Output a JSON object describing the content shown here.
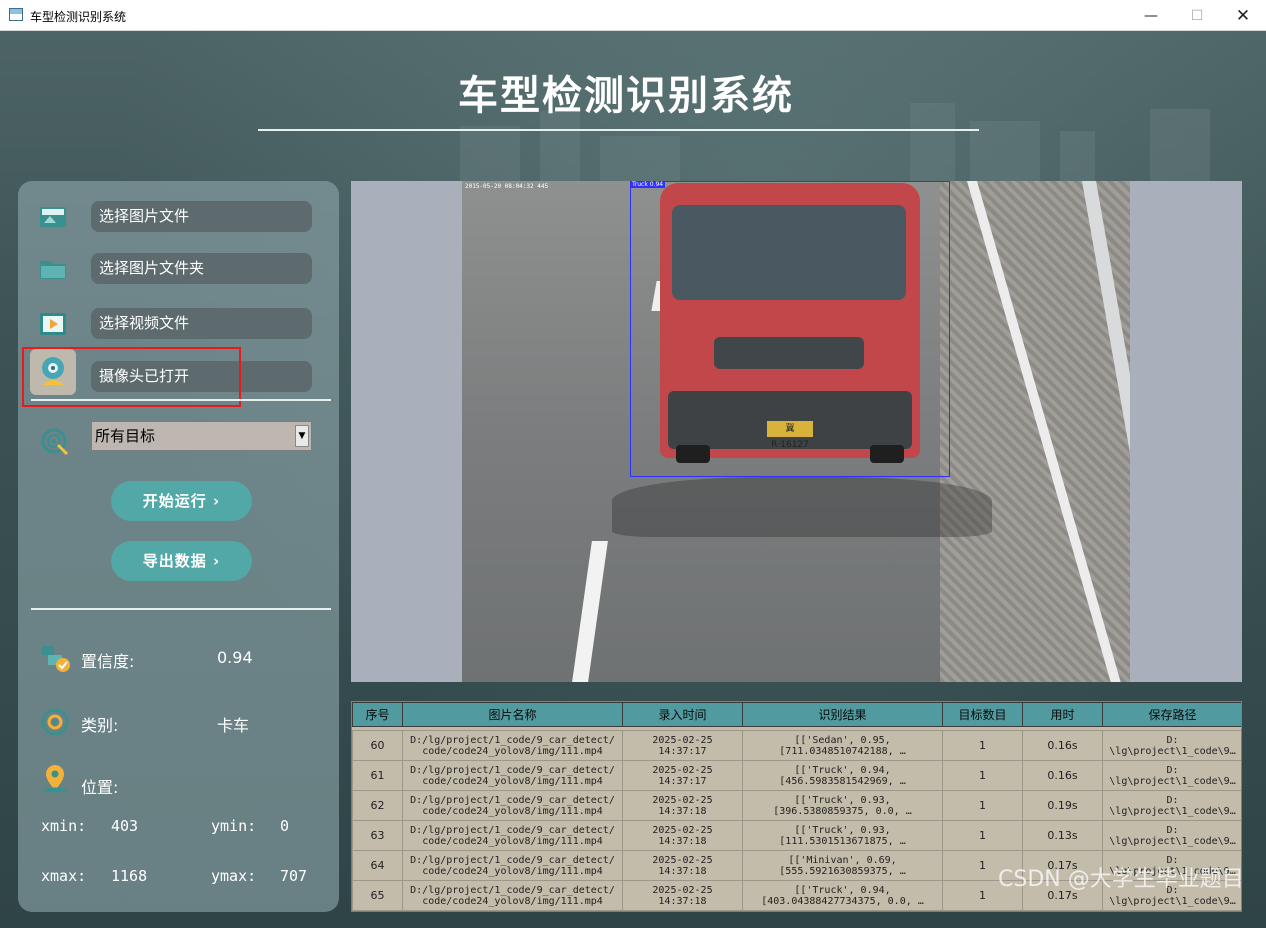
{
  "window": {
    "title": "车型检测识别系统",
    "min": "—",
    "max": "☐",
    "close": "✕"
  },
  "app_title": "车型检测识别系统",
  "sidebar": {
    "buttons": [
      {
        "label": "选择图片文件",
        "icon": "image-file-icon"
      },
      {
        "label": "选择图片文件夹",
        "icon": "folder-icon"
      },
      {
        "label": "选择视频文件",
        "icon": "video-file-icon"
      },
      {
        "label": "摄像头已打开",
        "icon": "camera-icon"
      }
    ],
    "target_select": {
      "value": "所有目标",
      "arrow": "▼"
    },
    "run_button": "开始运行 ›",
    "export_button": "导出数据 ›",
    "confidence": {
      "label": "置信度:",
      "value": "0.94"
    },
    "category": {
      "label": "类别:",
      "value": "卡车"
    },
    "position": {
      "label": "位置:"
    },
    "coords": {
      "xmin_label": "xmin:",
      "xmin": "403",
      "ymin_label": "ymin:",
      "ymin": "0",
      "xmax_label": "xmax:",
      "xmax": "1168",
      "ymax_label": "ymax:",
      "ymax": "707"
    }
  },
  "viewer": {
    "detection_label": "Truck 0.94",
    "plate": "冀R·16127",
    "timestamp": "2015-05-20 08:04:32 445"
  },
  "table": {
    "headers": [
      "序号",
      "图片名称",
      "录入时间",
      "识别结果",
      "目标数目",
      "用时",
      "保存路径"
    ],
    "rows": [
      [
        "60",
        "D:/lg/project/1_code/9_car_detect/\ncode/code24_yolov8/img/111.mp4",
        "2025-02-25\n14:37:17",
        "[['Sedan', 0.95,\n[711.0348510742188, …",
        "1",
        "0.16s",
        "D:\n\\lg\\project\\1_code\\9…"
      ],
      [
        "61",
        "D:/lg/project/1_code/9_car_detect/\ncode/code24_yolov8/img/111.mp4",
        "2025-02-25\n14:37:17",
        "[['Truck', 0.94,\n[456.5983581542969, …",
        "1",
        "0.16s",
        "D:\n\\lg\\project\\1_code\\9…"
      ],
      [
        "62",
        "D:/lg/project/1_code/9_car_detect/\ncode/code24_yolov8/img/111.mp4",
        "2025-02-25\n14:37:18",
        "[['Truck', 0.93,\n[396.5380859375, 0.0, …",
        "1",
        "0.19s",
        "D:\n\\lg\\project\\1_code\\9…"
      ],
      [
        "63",
        "D:/lg/project/1_code/9_car_detect/\ncode/code24_yolov8/img/111.mp4",
        "2025-02-25\n14:37:18",
        "[['Truck', 0.93,\n[111.5301513671875, …",
        "1",
        "0.13s",
        "D:\n\\lg\\project\\1_code\\9…"
      ],
      [
        "64",
        "D:/lg/project/1_code/9_car_detect/\ncode/code24_yolov8/img/111.mp4",
        "2025-02-25\n14:37:18",
        "[['Minivan', 0.69,\n[555.5921630859375, …",
        "1",
        "0.17s",
        "D:\n\\lg\\project\\1_code\\9…"
      ],
      [
        "65",
        "D:/lg/project/1_code/9_car_detect/\ncode/code24_yolov8/img/111.mp4",
        "2025-02-25\n14:37:18",
        "[['Truck', 0.94,\n[403.04388427734375, 0.0, …",
        "1",
        "0.17s",
        "D:\n\\lg\\project\\1_code\\9…"
      ]
    ]
  },
  "watermark": "CSDN @大学生毕业题目",
  "colors": {
    "accent": "#52a7a7",
    "table_header": "#519a9f",
    "highlight": "#e81a1a",
    "bbox": "#3030ff"
  }
}
